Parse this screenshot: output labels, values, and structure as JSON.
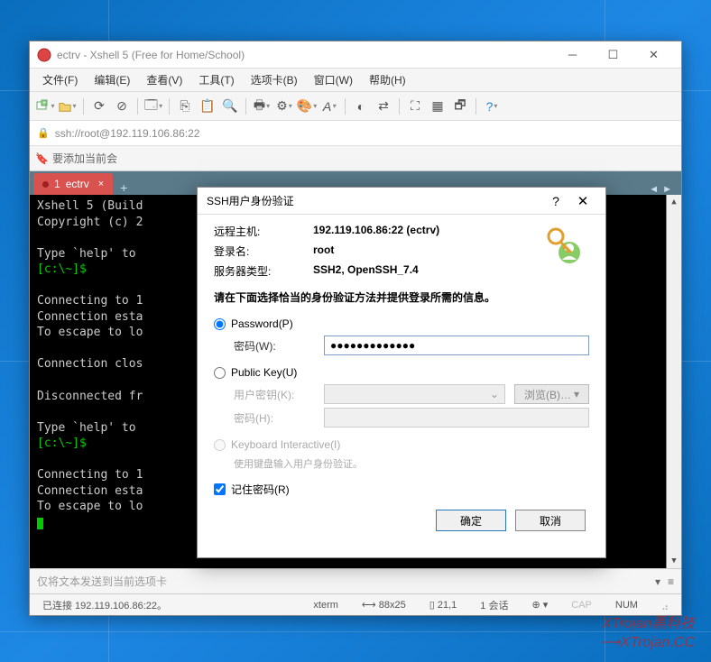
{
  "window": {
    "title": "ectrv - Xshell 5 (Free for Home/School)"
  },
  "menubar": {
    "items": [
      "文件(F)",
      "编辑(E)",
      "查看(V)",
      "工具(T)",
      "选项卡(B)",
      "窗口(W)",
      "帮助(H)"
    ]
  },
  "addressbar": {
    "url": "ssh://root@192.119.106.86:22"
  },
  "quickbar": {
    "text": "要添加当前会"
  },
  "tab": {
    "index": "1",
    "label": "ectrv"
  },
  "terminal": {
    "line1": "Xshell 5 (Build",
    "line2": "Copyright (c) 2",
    "line3": "Type `help' to ",
    "prompt1": "[c:\\~]$ ",
    "line4": "Connecting to 1",
    "line5": "Connection esta",
    "line6": "To escape to lo",
    "line7": "Connection clos",
    "line8": "Disconnected fr",
    "line9": "Type `help' to ",
    "prompt2": "[c:\\~]$ ",
    "line10": "Connecting to 1",
    "line11": "Connection esta",
    "line12": "To escape to lo"
  },
  "sendbar": {
    "placeholder": "仅将文本发送到当前选项卡"
  },
  "statusbar": {
    "conn": "已连接 192.119.106.86:22。",
    "term": "xterm",
    "size": "88x25",
    "pos": "21,1",
    "sessions": "1 会话",
    "cap": "CAP",
    "num": "NUM"
  },
  "dialog": {
    "title": "SSH用户身份验证",
    "remote_host_label": "远程主机:",
    "remote_host": "192.119.106.86:22 (ectrv)",
    "login_label": "登录名:",
    "login": "root",
    "server_type_label": "服务器类型:",
    "server_type": "SSH2, OpenSSH_7.4",
    "instruction": "请在下面选择恰当的身份验证方法并提供登录所需的信息。",
    "password_opt": "Password(P)",
    "password_label": "密码(W):",
    "password_value": "●●●●●●●●●●●●●",
    "publickey_opt": "Public Key(U)",
    "userkey_label": "用户密钥(K):",
    "passphrase_label": "密码(H):",
    "browse_btn": "浏览(B)…",
    "keyboard_opt": "Keyboard Interactive(I)",
    "keyboard_hint": "使用键盘输入用户身份验证。",
    "remember_label": "记住密码(R)",
    "ok_btn": "确定",
    "cancel_btn": "取消"
  },
  "watermark": {
    "line1": "XTrojan黑科技",
    "line2": "XTrojan.CC"
  }
}
